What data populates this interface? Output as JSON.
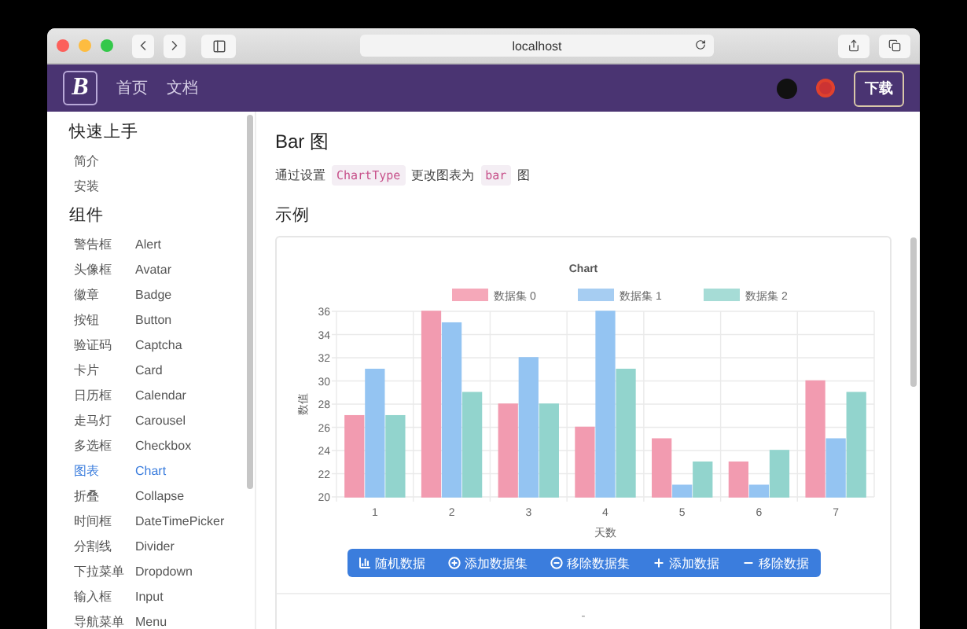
{
  "browser": {
    "address": "localhost"
  },
  "navbar": {
    "logo": "B",
    "links": [
      {
        "label": "首页"
      },
      {
        "label": "文档"
      }
    ],
    "download_button": "下载"
  },
  "sidebar": {
    "sections": [
      {
        "title": "快速上手",
        "items": [
          {
            "label": "简介",
            "selected": false
          },
          {
            "label": "安装",
            "selected": false
          }
        ]
      },
      {
        "title": "组件",
        "items": [
          {
            "label": "警告框",
            "name": "Alert",
            "selected": false
          },
          {
            "label": "头像框",
            "name": "Avatar",
            "selected": false
          },
          {
            "label": "徽章",
            "name": "Badge",
            "selected": false
          },
          {
            "label": "按钮",
            "name": "Button",
            "selected": false
          },
          {
            "label": "验证码",
            "name": "Captcha",
            "selected": false
          },
          {
            "label": "卡片",
            "name": "Card",
            "selected": false
          },
          {
            "label": "日历框",
            "name": "Calendar",
            "selected": false
          },
          {
            "label": "走马灯",
            "name": "Carousel",
            "selected": false
          },
          {
            "label": "多选框",
            "name": "Checkbox",
            "selected": false
          },
          {
            "label": "图表",
            "name": "Chart",
            "selected": true
          },
          {
            "label": "折叠",
            "name": "Collapse",
            "selected": false
          },
          {
            "label": "时间框",
            "name": "DateTimePicker",
            "selected": false
          },
          {
            "label": "分割线",
            "name": "Divider",
            "selected": false
          },
          {
            "label": "下拉菜单",
            "name": "Dropdown",
            "selected": false
          },
          {
            "label": "输入框",
            "name": "Input",
            "selected": false
          },
          {
            "label": "导航菜单",
            "name": "Menu",
            "selected": false
          }
        ]
      }
    ]
  },
  "content": {
    "title": "Bar 图",
    "description": [
      {
        "kind": "text",
        "text": "通过设置"
      },
      {
        "kind": "code",
        "text": "ChartType"
      },
      {
        "kind": "text",
        "text": "更改图表为"
      },
      {
        "kind": "code",
        "text": "bar"
      },
      {
        "kind": "text",
        "text": "图"
      }
    ],
    "section_title": "示例",
    "chart_data": {
      "type": "bar",
      "grid": true,
      "legend": true,
      "title": "Chart",
      "xlabel": "天数",
      "ylabel": "数值",
      "categories": [
        "1",
        "2",
        "3",
        "4",
        "5",
        "6",
        "7"
      ],
      "ylim": [
        20,
        36
      ],
      "yticks": [
        20,
        22,
        24,
        26,
        28,
        30,
        32,
        34,
        36
      ],
      "series": [
        {
          "name": "数据集 0",
          "color": "#f5a8b9",
          "values": [
            27,
            36,
            28,
            26,
            25,
            23,
            30
          ]
        },
        {
          "name": "数据集 1",
          "color": "#a6cdf2",
          "values": [
            31,
            35,
            32,
            36,
            21,
            21,
            25
          ]
        },
        {
          "name": "数据集 2",
          "color": "#a6dcd6",
          "values": [
            27,
            29,
            28,
            31,
            23,
            24,
            29
          ]
        }
      ]
    },
    "buttons": [
      {
        "kind": "chart",
        "label": "随机数据"
      },
      {
        "kind": "add-circle",
        "label": "添加数据集"
      },
      {
        "kind": "remove-circle",
        "label": "移除数据集"
      },
      {
        "kind": "add",
        "label": "添加数据"
      },
      {
        "kind": "remove",
        "label": "移除数据"
      }
    ],
    "footer_text": "-"
  }
}
